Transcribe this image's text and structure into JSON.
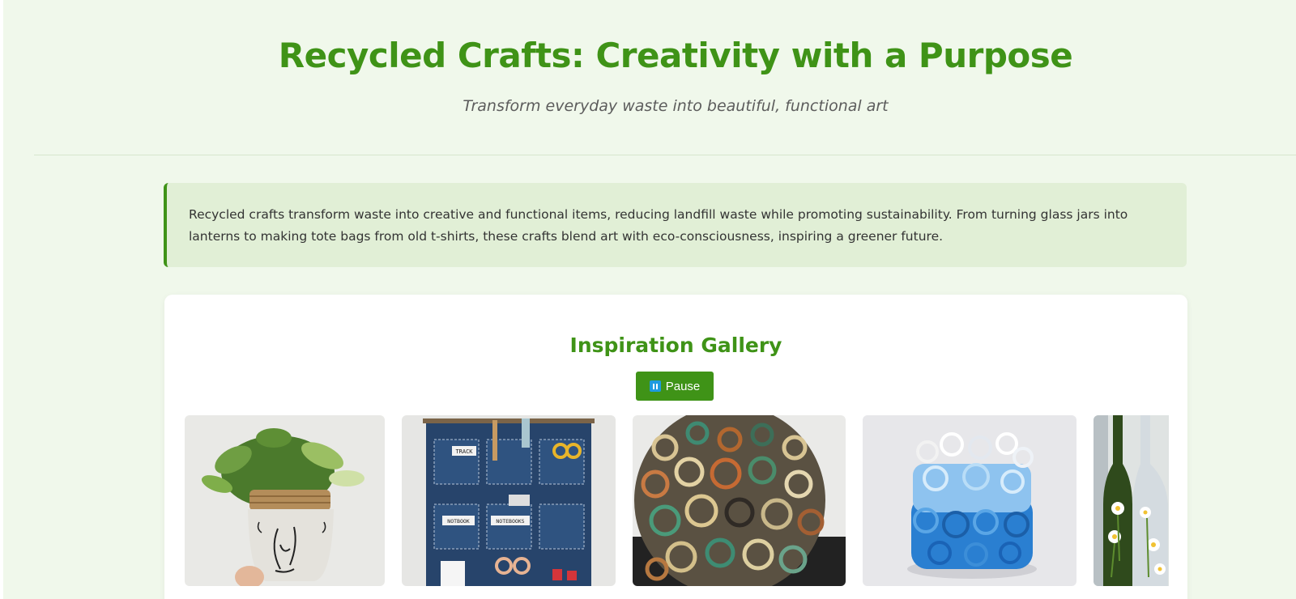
{
  "header": {
    "title": "Recycled Crafts: Creativity with a Purpose",
    "subtitle": "Transform everyday waste into beautiful, functional art"
  },
  "intro": {
    "text": "Recycled crafts transform waste into creative and functional items, reducing landfill waste while promoting sustainability. From turning glass jars into lanterns to making tote bags from old t-shirts, these crafts blend art with eco-consciousness, inspiring a greener future."
  },
  "gallery": {
    "title": "Inspiration Gallery",
    "pause_label": "Pause",
    "pause_icon": "pause-icon",
    "slides": [
      {
        "subject": "plastic-bottle-planter-with-face"
      },
      {
        "subject": "denim-pocket-organizer",
        "labels": [
          "TRACK",
          "NOTBOOK",
          "NOTEBOOKS"
        ]
      },
      {
        "subject": "rolled-paper-coil-sphere"
      },
      {
        "subject": "blue-paper-coil-vase"
      },
      {
        "subject": "painted-glass-bottles"
      }
    ]
  },
  "colors": {
    "accent": "#3f9317",
    "background": "#f0f8eb",
    "intro_background": "#e1efd6",
    "card": "#ffffff"
  }
}
